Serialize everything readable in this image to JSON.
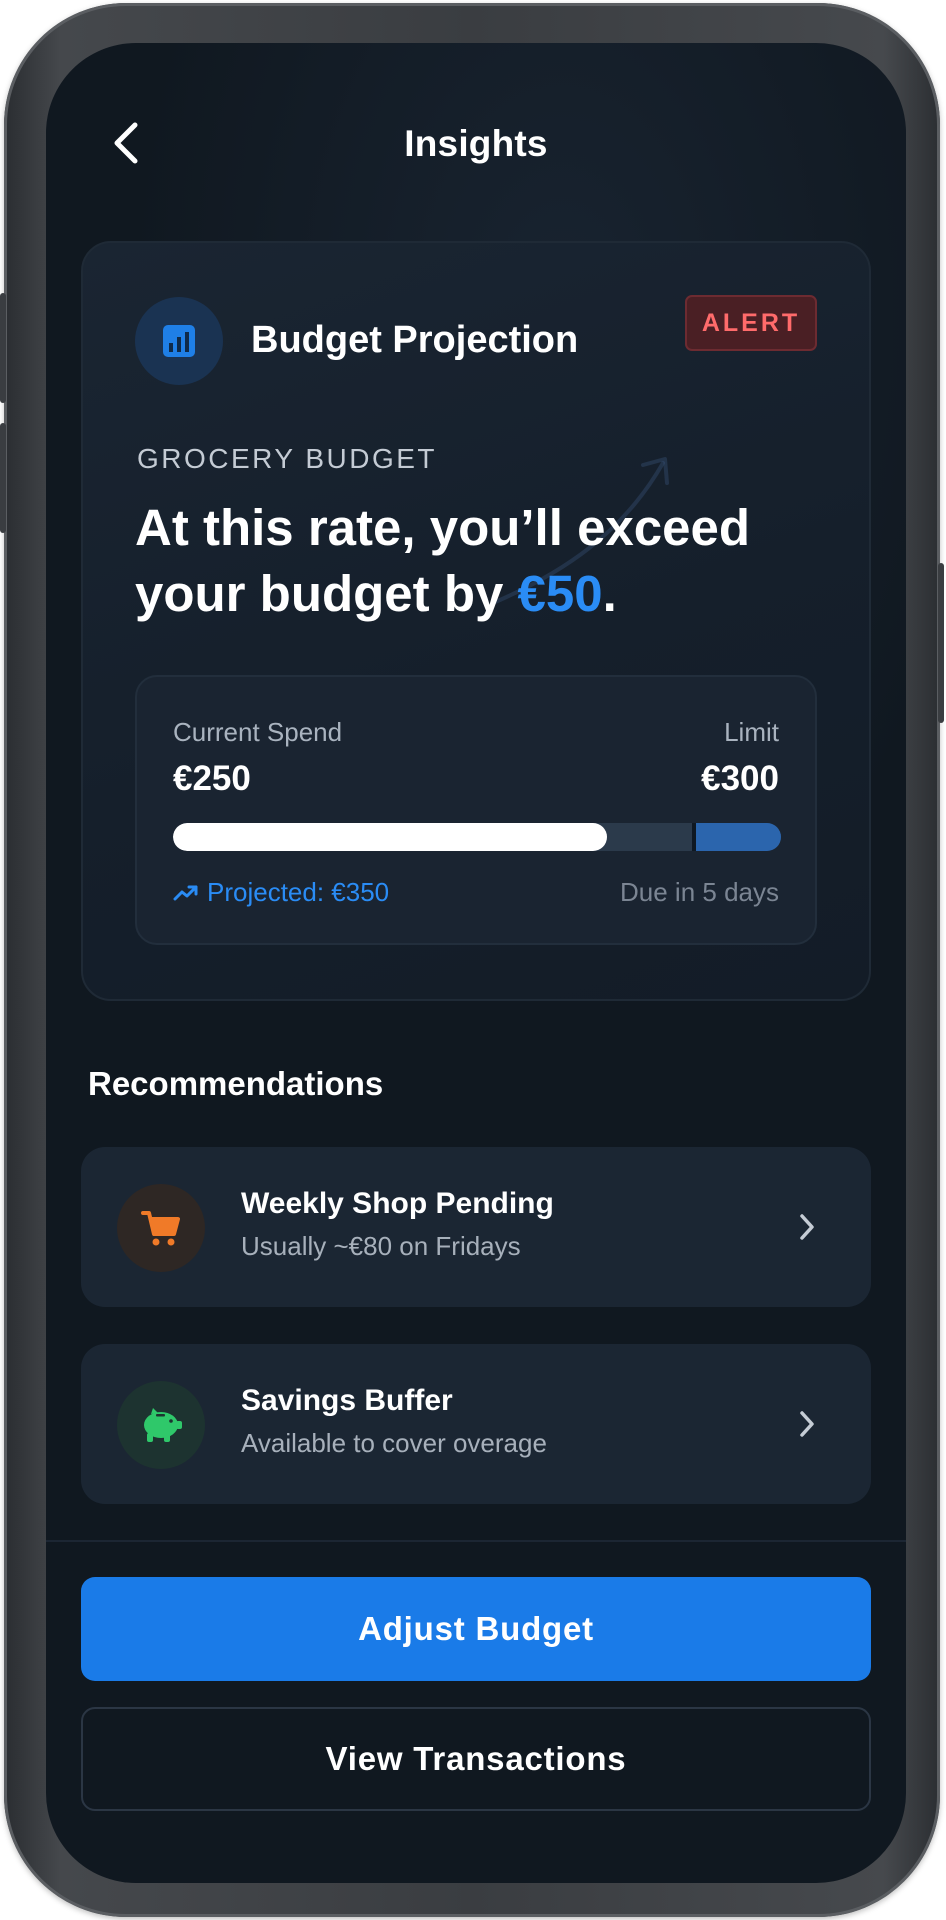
{
  "header": {
    "title": "Insights",
    "back_icon": "chevron-left-icon"
  },
  "projection_card": {
    "icon": "bar-chart-icon",
    "title": "Budget Projection",
    "badge": "ALERT",
    "category": "GROCERY BUDGET",
    "headline_before": "At this rate, you’ll exceed your budget by ",
    "headline_amount": "€50",
    "headline_after": ".",
    "current_label": "Current Spend",
    "current_value": "€250",
    "limit_label": "Limit",
    "limit_value": "€300",
    "projected_icon": "trending-up-icon",
    "projected_text": "Projected: €350",
    "due_text": "Due in 5 days",
    "progress": {
      "spent": 250,
      "limit": 300,
      "projected": 350
    }
  },
  "recommendations": {
    "title": "Recommendations",
    "items": [
      {
        "icon": "shopping-cart-icon",
        "title": "Weekly Shop Pending",
        "subtitle": "Usually ~€80 on Fridays"
      },
      {
        "icon": "piggy-bank-icon",
        "title": "Savings Buffer",
        "subtitle": "Available to cover overage"
      }
    ]
  },
  "actions": {
    "primary": "Adjust Budget",
    "secondary": "View Transactions"
  },
  "colors": {
    "background": "#101820",
    "accent": "#1a7be8",
    "alert": "#ff6b6b",
    "cart": "#f07a28",
    "savings": "#2fc86a"
  }
}
